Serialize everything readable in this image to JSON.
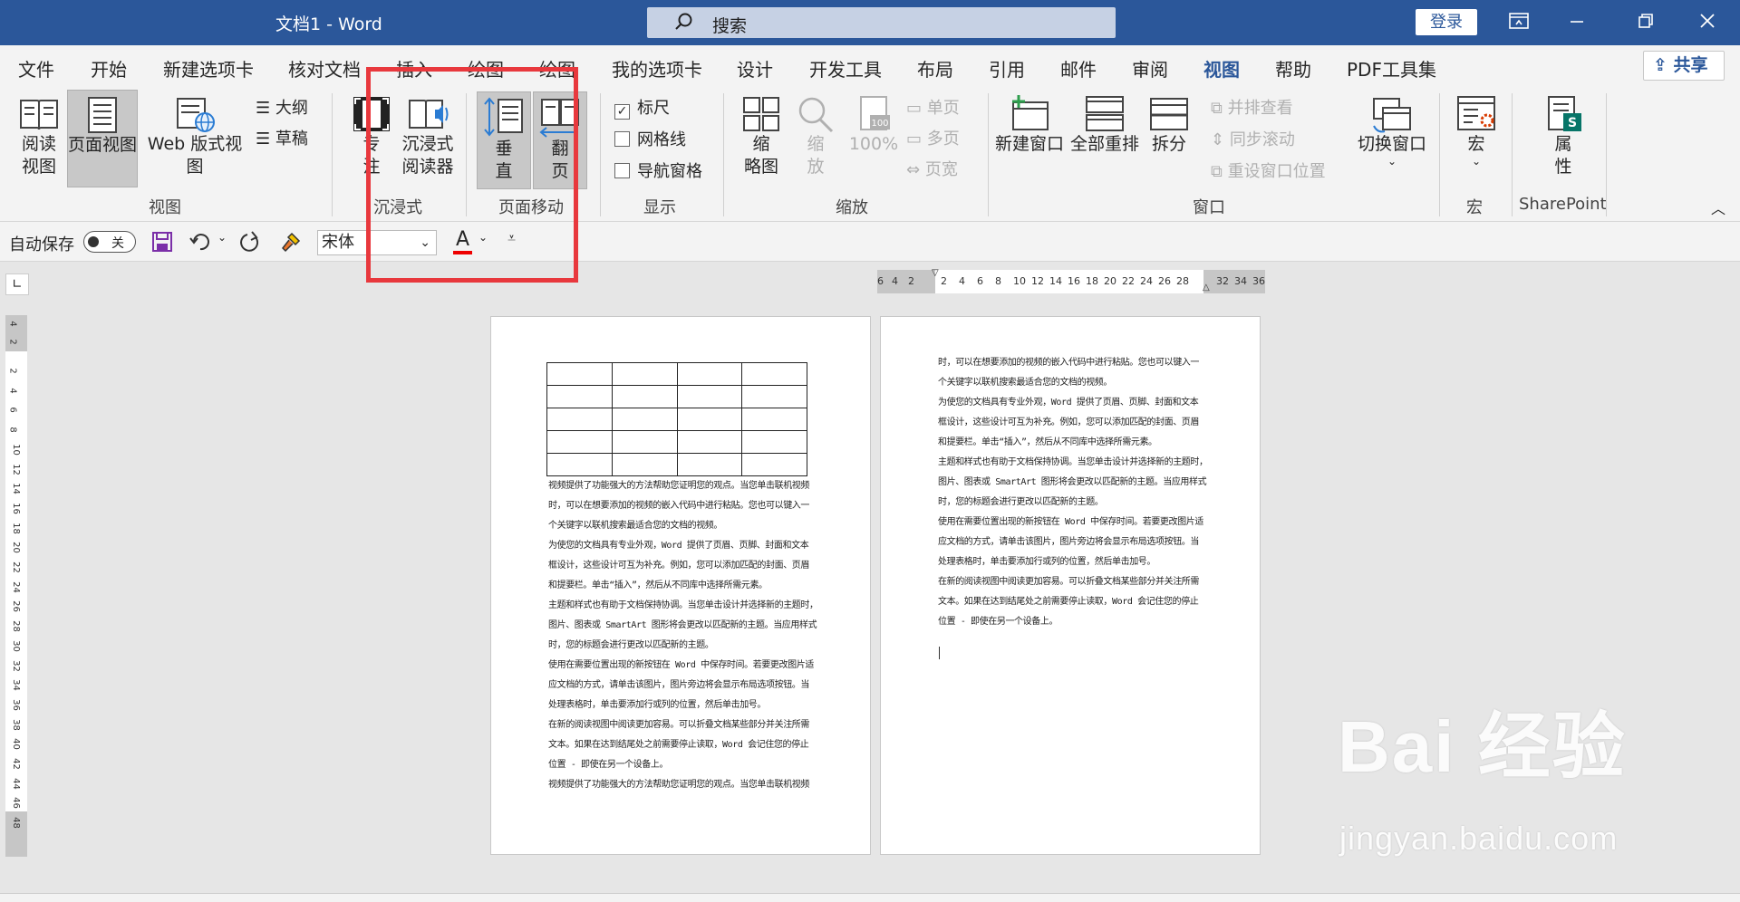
{
  "window": {
    "title": "文档1 - Word",
    "login": "登录"
  },
  "search": {
    "placeholder": "搜索"
  },
  "tabs": [
    "文件",
    "开始",
    "新建选项卡",
    "核对文档",
    "插入",
    "绘图",
    "绘图",
    "我的选项卡",
    "设计",
    "开发工具",
    "布局",
    "引用",
    "邮件",
    "审阅",
    "视图",
    "帮助",
    "PDF工具集"
  ],
  "active_tab": "视图",
  "share": "共享",
  "ribbon": {
    "view": {
      "reading": "阅读\n视图",
      "page": "页面视图",
      "web": "Web 版式视图",
      "outline": "大纲",
      "draft": "草稿",
      "label": "视图"
    },
    "immersive": {
      "focus": "专\n注",
      "reader": "沉浸式\n阅读器",
      "label": "沉浸式"
    },
    "page_move": {
      "vertical": "垂\n直",
      "flip": "翻\n页",
      "label": "页面移动"
    },
    "show": {
      "ruler": "标尺",
      "gridlines": "网格线",
      "nav": "导航窗格",
      "label": "显示"
    },
    "zoom": {
      "thumb": "缩\n略图",
      "zoom": "缩\n放",
      "percent": "100%",
      "one_page": "单页",
      "multi_page": "多页",
      "page_width": "页宽",
      "label": "缩放"
    },
    "window": {
      "new": "新建窗口",
      "arrange": "全部重排",
      "split": "拆分",
      "side": "并排查看",
      "sync": "同步滚动",
      "reset": "重设窗口位置",
      "switch": "切换窗口",
      "label": "窗口"
    },
    "macro": {
      "btn": "宏",
      "label": "宏"
    },
    "sharepoint": {
      "btn": "属\n性",
      "label": "SharePoint"
    }
  },
  "qat": {
    "autosave": "自动保存",
    "toggle": "关",
    "font": "宋体",
    "font_color": "A"
  },
  "ruler": {
    "h": [
      "6",
      "4",
      "2",
      "2",
      "4",
      "6",
      "8",
      "10",
      "12",
      "14",
      "16",
      "18",
      "20",
      "22",
      "24",
      "26",
      "28",
      "32",
      "34",
      "36"
    ],
    "v": [
      "4",
      "2",
      "2",
      "4",
      "6",
      "8",
      "10",
      "12",
      "14",
      "16",
      "18",
      "20",
      "22",
      "24",
      "26",
      "28",
      "30",
      "32",
      "34",
      "36",
      "38",
      "40",
      "42",
      "44",
      "46",
      "48"
    ]
  },
  "page1": [
    "视频提供了功能强大的方法帮助您证明您的观点。当您单击联机视频",
    "时，可以在想要添加的视频的嵌入代码中进行粘贴。您也可以键入一",
    "个关键字以联机搜索最适合您的文档的视频。",
    "为使您的文档具有专业外观，Word 提供了页眉、页脚、封面和文本",
    "框设计，这些设计可互为补充。例如，您可以添加匹配的封面、页眉",
    "和提要栏。单击“插入”，然后从不同库中选择所需元素。",
    "主题和样式也有助于文档保持协调。当您单击设计并选择新的主题时，",
    "图片、图表或 SmartArt 图形将会更改以匹配新的主题。当应用样式",
    "时，您的标题会进行更改以匹配新的主题。",
    "使用在需要位置出现的新按钮在 Word 中保存时间。若要更改图片适",
    "应文档的方式，请单击该图片，图片旁边将会显示布局选项按钮。当",
    "处理表格时，单击要添加行或列的位置，然后单击加号。",
    "在新的阅读视图中阅读更加容易。可以折叠文档某些部分并关注所需",
    "文本。如果在达到结尾处之前需要停止读取，Word 会记住您的停止",
    "位置 - 即使在另一个设备上。",
    "视频提供了功能强大的方法帮助您证明您的观点。当您单击联机视频"
  ],
  "page2": [
    "时，可以在想要添加的视频的嵌入代码中进行粘贴。您也可以键入一",
    "个关键字以联机搜索最适合您的文档的视频。",
    "为使您的文档具有专业外观，Word 提供了页眉、页脚、封面和文本",
    "框设计，这些设计可互为补充。例如，您可以添加匹配的封面、页眉",
    "和提要栏。单击“插入”，然后从不同库中选择所需元素。",
    "主题和样式也有助于文档保持协调。当您单击设计并选择新的主题时，",
    "图片、图表或 SmartArt 图形将会更改以匹配新的主题。当应用样式",
    "时，您的标题会进行更改以匹配新的主题。",
    "使用在需要位置出现的新按钮在 Word 中保存时间。若要更改图片适",
    "应文档的方式，请单击该图片，图片旁边将会显示布局选项按钮。当",
    "处理表格时，单击要添加行或列的位置，然后单击加号。",
    "在新的阅读视图中阅读更加容易。可以折叠文档某些部分并关注所需",
    "文本。如果在达到结尾处之前需要停止读取，Word 会记住您的停止",
    "位置 - 即使在另一个设备上。"
  ],
  "watermark": {
    "main": "Bai 经验",
    "sub": "jingyan.baidu.com"
  }
}
